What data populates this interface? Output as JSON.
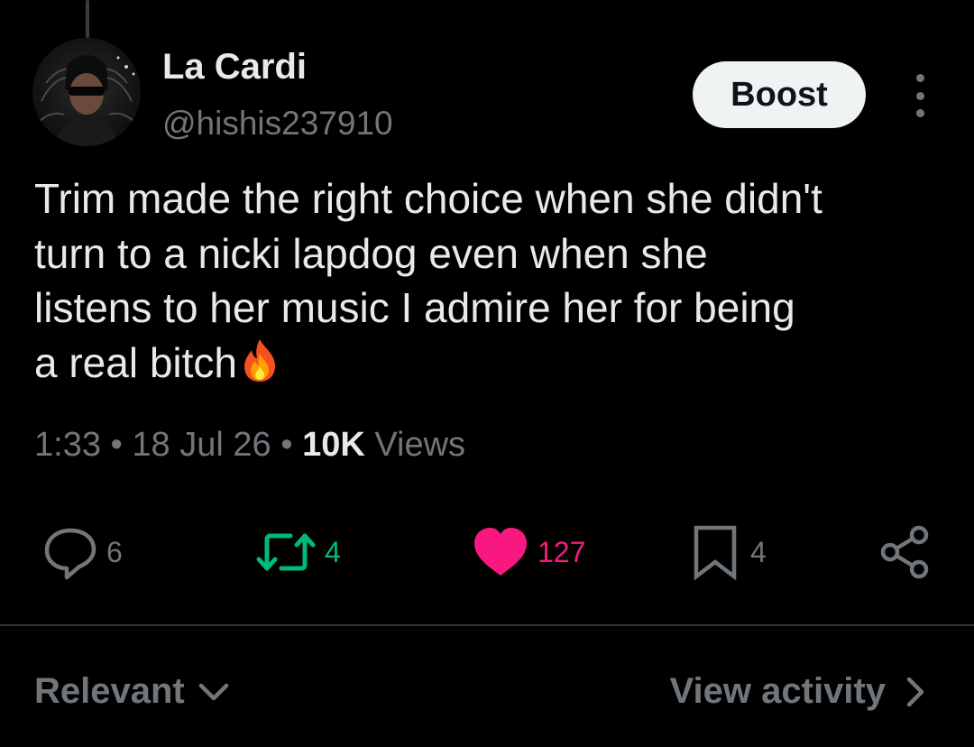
{
  "author": {
    "display_name": "La Cardi",
    "handle": "@hishis237910"
  },
  "header": {
    "boost_label": "Boost",
    "more_icon": "more-vertical-icon"
  },
  "tweet": {
    "lines": [
      "Trim made the right choice when she didn't",
      "turn to a nicki lapdog even when she",
      "listens to her music  I admire her for being",
      "a real bitch"
    ],
    "emoji": "fire-emoji"
  },
  "meta": {
    "time": "1:33",
    "separator": "•",
    "date": "18 Jul 26",
    "views_count": "10K",
    "views_label": "Views"
  },
  "actions": {
    "replies": "6",
    "reposts": "4",
    "likes": "127",
    "bookmarks": "4",
    "like_active": true,
    "icons": [
      "reply-icon",
      "repost-icon",
      "heart-icon",
      "bookmark-icon",
      "share-icon"
    ]
  },
  "footer": {
    "sort_label": "Relevant",
    "view_activity_label": "View activity"
  },
  "colors": {
    "background": "#000000",
    "text": "#e7e9ea",
    "muted": "#71767b",
    "repost_green": "#00ba7c",
    "like_pink": "#f91880",
    "divider": "#2f3336"
  }
}
